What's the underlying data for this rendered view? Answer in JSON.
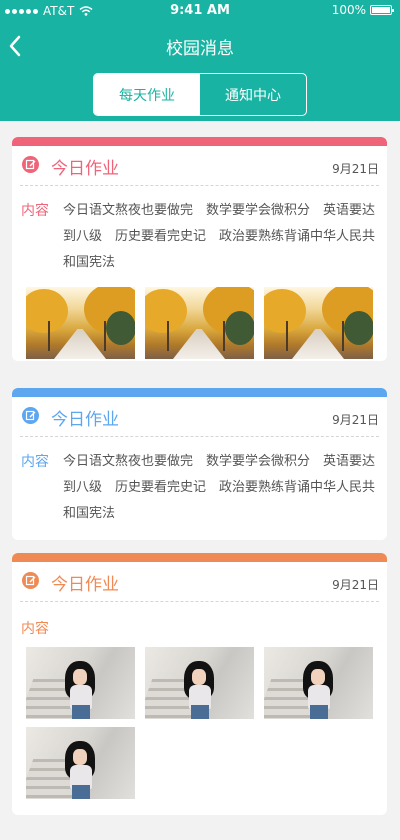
{
  "status_bar": {
    "carrier": "AT&T",
    "time": "9:41 AM",
    "battery": "100%"
  },
  "nav": {
    "title": "校园消息"
  },
  "segments": [
    {
      "label": "每天作业",
      "active": true
    },
    {
      "label": "通知中心",
      "active": false
    }
  ],
  "colors": {
    "header": "#18b3a2",
    "card_red": "#f0647a",
    "card_blue": "#5da6f0",
    "card_orange": "#f08a55"
  },
  "cards": [
    {
      "title": "今日作业",
      "date": "9月21日",
      "content_label": "内容",
      "content_text": "今日语文熬夜也要做完　数学要学会微积分　英语要达到八级　历史要看完史记　政治要熟练背诵中华人民共和国宪法",
      "images": [
        "autumn-photo",
        "autumn-photo",
        "autumn-photo"
      ]
    },
    {
      "title": "今日作业",
      "date": "9月21日",
      "content_label": "内容",
      "content_text": "今日语文熬夜也要做完　数学要学会微积分　英语要达到八级　历史要看完史记　政治要熟练背诵中华人民共和国宪法"
    },
    {
      "title": "今日作业",
      "date": "9月21日",
      "content_label": "内容",
      "images": [
        "portrait-photo",
        "portrait-photo",
        "portrait-photo",
        "portrait-photo"
      ]
    }
  ]
}
